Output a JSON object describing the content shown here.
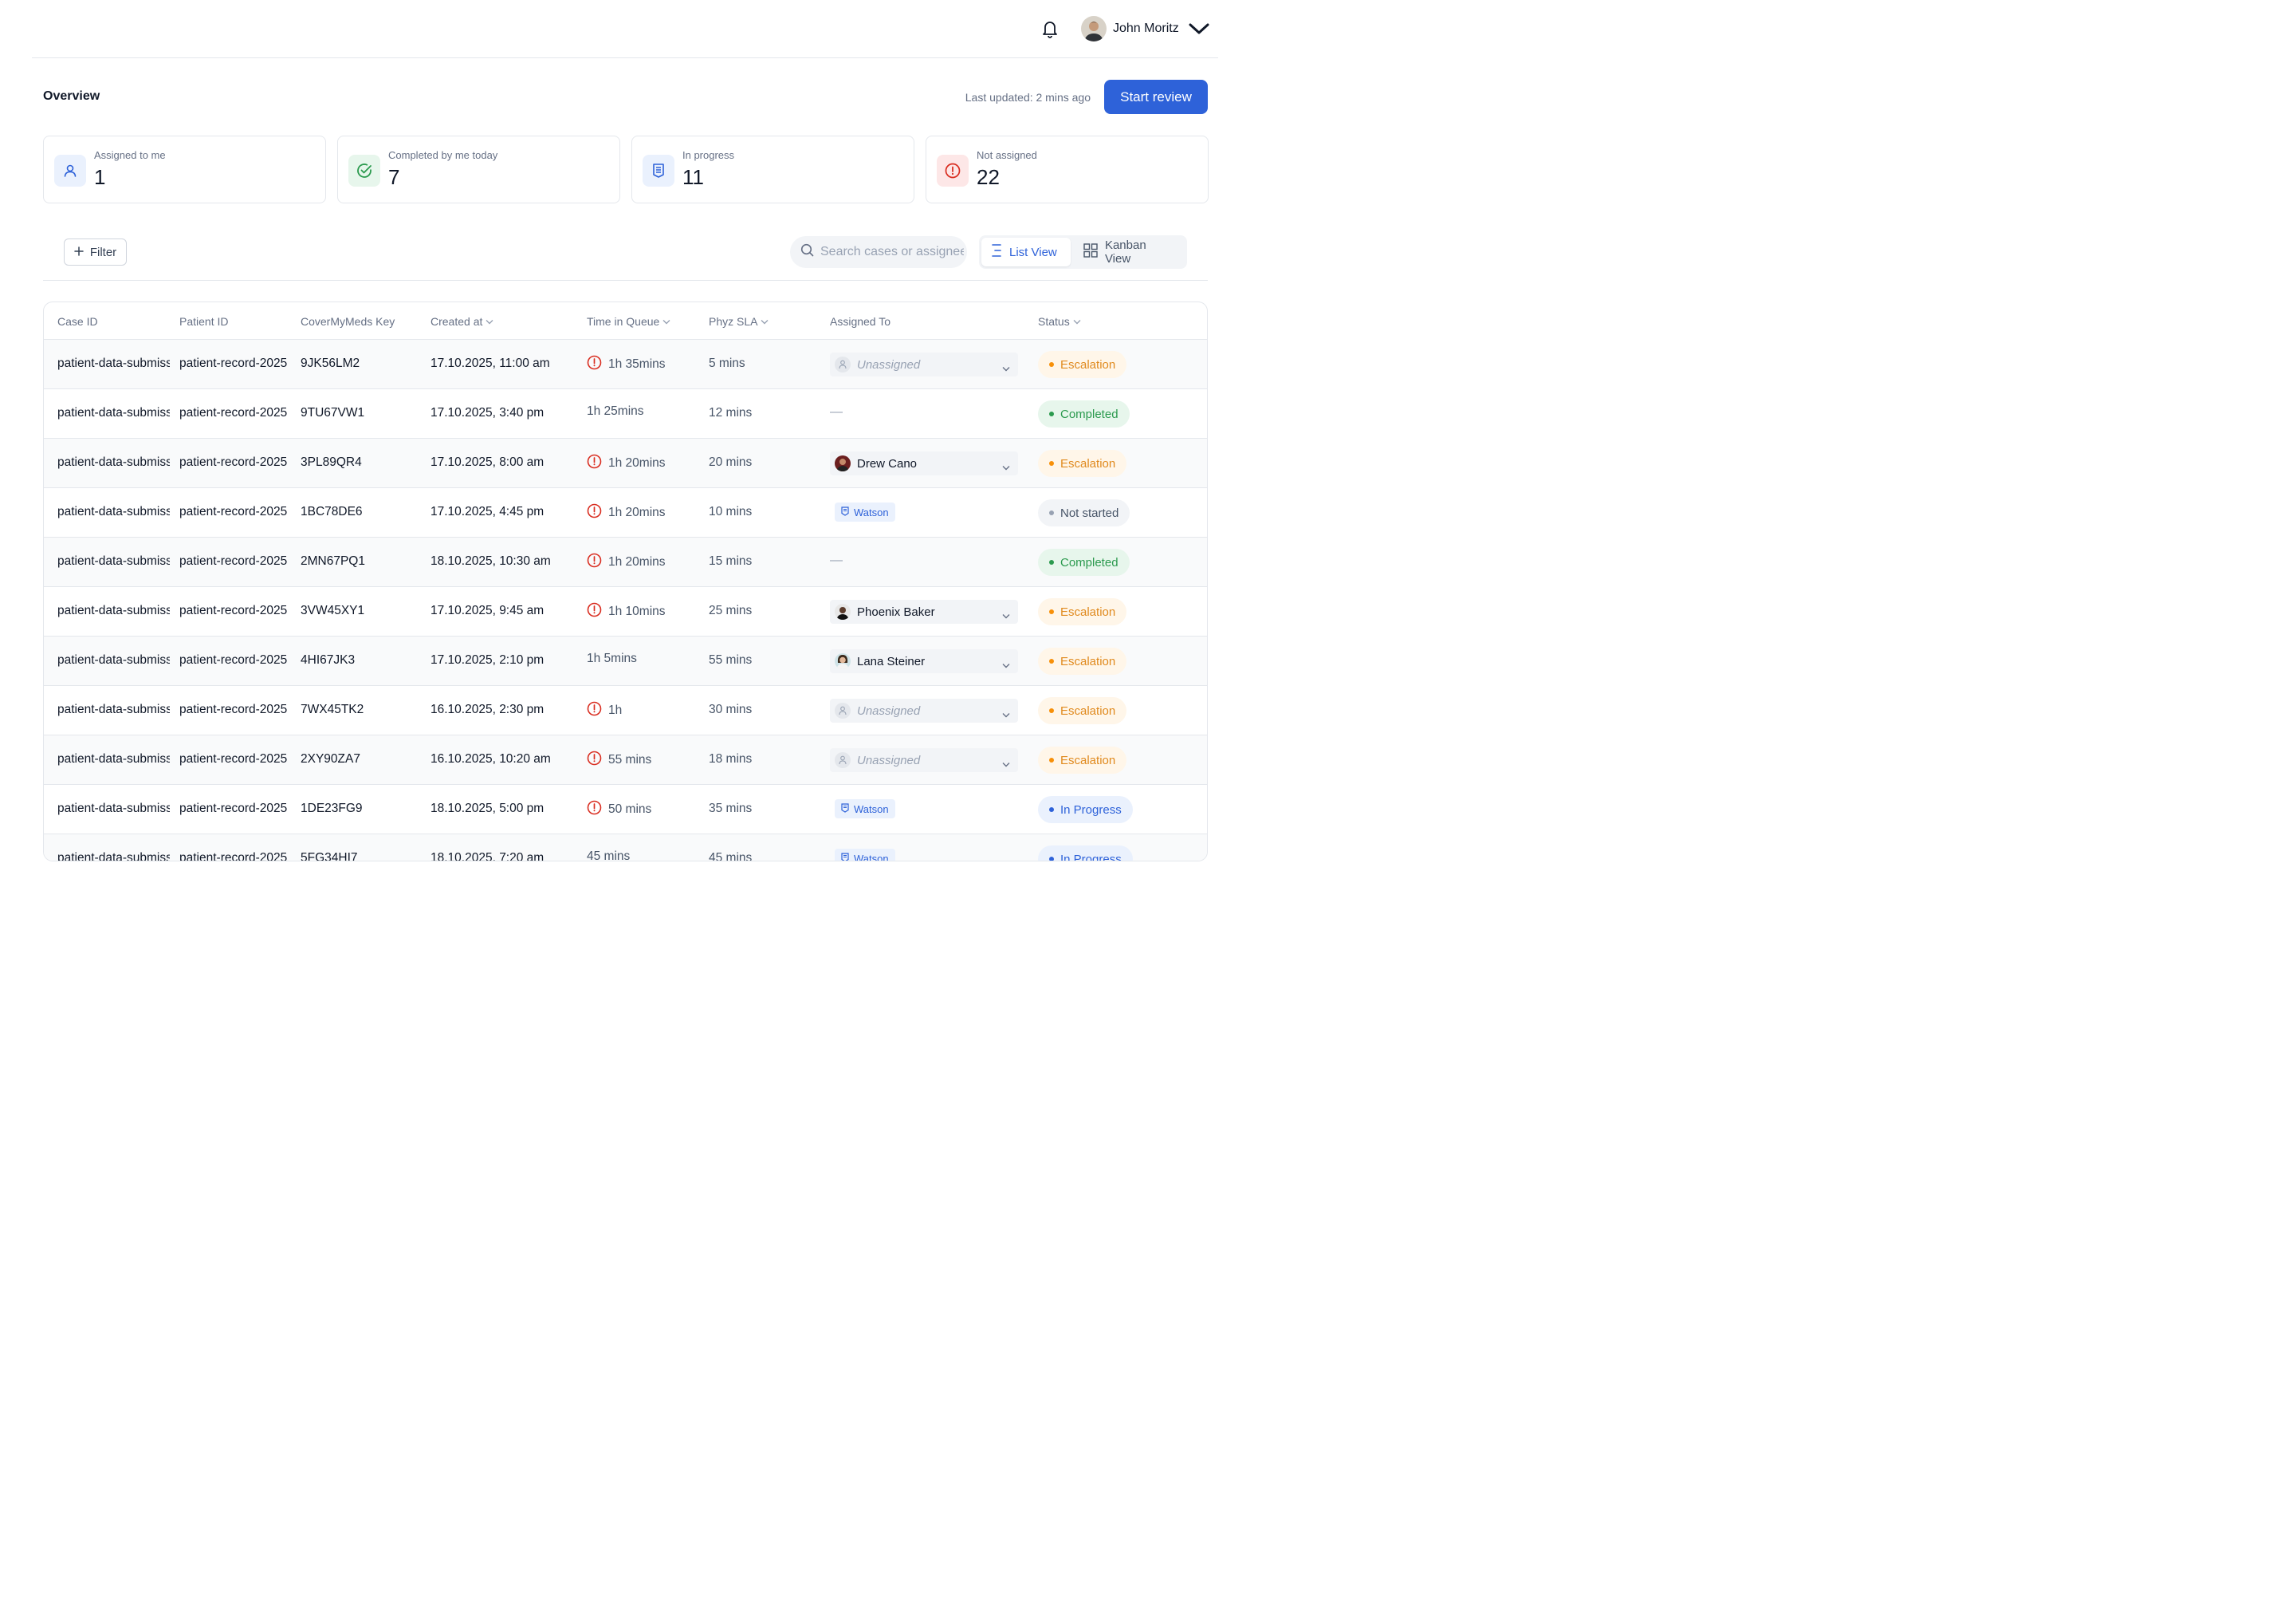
{
  "header": {
    "user_name": "John Moritz"
  },
  "overview": {
    "title": "Overview",
    "last_updated": "Last updated: 2 mins ago",
    "start_review_label": "Start review"
  },
  "stats": [
    {
      "label": "Assigned to me",
      "value": "1",
      "icon": "user-icon",
      "color": "#2e62d9"
    },
    {
      "label": "Completed by me today",
      "value": "7",
      "icon": "check-circle-icon",
      "color": "#2b9a4e"
    },
    {
      "label": "In progress",
      "value": "11",
      "icon": "badge-icon",
      "color": "#2e62d9"
    },
    {
      "label": "Not assigned",
      "value": "22",
      "icon": "alert-circle-icon",
      "color": "#d92d20"
    }
  ],
  "toolbar": {
    "filter_label": "Filter",
    "search_placeholder": "Search cases or assignee",
    "list_view_label": "List View",
    "kanban_view_label": "Kanban View"
  },
  "table": {
    "columns": {
      "case_id": "Case ID",
      "patient_id": "Patient ID",
      "key": "CoverMyMeds Key",
      "created": "Created at",
      "queue": "Time in Queue",
      "sla": "Phyz SLA",
      "assigned": "Assigned To",
      "status": "Status"
    },
    "unassigned_label": "Unassigned",
    "watson_label": "Watson",
    "dash": "—",
    "rows": [
      {
        "case_id": "patient-data-submission",
        "patient_id": "patient-record-2025",
        "key": "9JK56LM2",
        "created": "17.10.2025, 11:00 am",
        "queue": "1h 35mins",
        "sla": "5 mins",
        "assigned": "Unassigned",
        "status": "Escalation"
      },
      {
        "case_id": "patient-data-submission",
        "patient_id": "patient-record-2025",
        "key": "9TU67VW1",
        "created": "17.10.2025, 3:40 pm",
        "queue": "1h 25mins",
        "sla": "12 mins",
        "assigned": "—",
        "status": "Completed"
      },
      {
        "case_id": "patient-data-submission",
        "patient_id": "patient-record-2025",
        "key": "3PL89QR4",
        "created": "17.10.2025, 8:00 am",
        "queue": "1h 20mins",
        "sla": "20 mins",
        "assigned": "Drew Cano",
        "status": "Escalation"
      },
      {
        "case_id": "patient-data-submission",
        "patient_id": "patient-record-2025",
        "key": "1BC78DE6",
        "created": "17.10.2025, 4:45 pm",
        "queue": "1h 20mins",
        "sla": "10 mins",
        "assigned": "Watson",
        "status": "Not started"
      },
      {
        "case_id": "patient-data-submission",
        "patient_id": "patient-record-2025",
        "key": "2MN67PQ1",
        "created": "18.10.2025, 10:30 am",
        "queue": "1h 20mins",
        "sla": "15 mins",
        "assigned": "—",
        "status": "Completed"
      },
      {
        "case_id": "patient-data-submission",
        "patient_id": "patient-record-2025",
        "key": "3VW45XY1",
        "created": "17.10.2025, 9:45 am",
        "queue": "1h 10mins",
        "sla": "25 mins",
        "assigned": "Phoenix Baker",
        "status": "Escalation"
      },
      {
        "case_id": "patient-data-submission",
        "patient_id": "patient-record-2025",
        "key": "4HI67JK3",
        "created": "17.10.2025, 2:10 pm",
        "queue": "1h 5mins",
        "sla": "55 mins",
        "assigned": "Lana Steiner",
        "status": "Escalation"
      },
      {
        "case_id": "patient-data-submission",
        "patient_id": "patient-record-2025",
        "key": "7WX45TK2",
        "created": "16.10.2025, 2:30 pm",
        "queue": "1h",
        "sla": "30 mins",
        "assigned": "Unassigned",
        "status": "Escalation"
      },
      {
        "case_id": "patient-data-submission",
        "patient_id": "patient-record-2025",
        "key": "2XY90ZA7",
        "created": "16.10.2025, 10:20 am",
        "queue": "55 mins",
        "sla": "18 mins",
        "assigned": "Unassigned",
        "status": "Escalation"
      },
      {
        "case_id": "patient-data-submission",
        "patient_id": "patient-record-2025",
        "key": "1DE23FG9",
        "created": "18.10.2025, 5:00 pm",
        "queue": "50 mins",
        "sla": "35 mins",
        "assigned": "Watson",
        "status": "In Progress"
      },
      {
        "case_id": "patient-data-submission",
        "patient_id": "patient-record-2025",
        "key": "5FG34HI7",
        "created": "18.10.2025, 7:20 am",
        "queue": "45 mins",
        "sla": "45 mins",
        "assigned": "Watson",
        "status": "In Progress"
      }
    ]
  }
}
